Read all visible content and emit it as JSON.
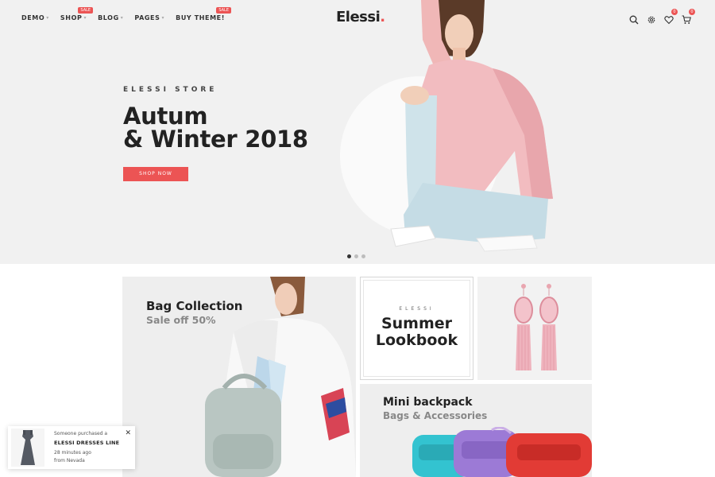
{
  "nav": {
    "items": [
      {
        "label": "DEMO",
        "has_dropdown": true,
        "badge": ""
      },
      {
        "label": "SHOP",
        "has_dropdown": true,
        "badge": "SALE"
      },
      {
        "label": "BLOG",
        "has_dropdown": true,
        "badge": ""
      },
      {
        "label": "PAGES",
        "has_dropdown": true,
        "badge": ""
      },
      {
        "label": "BUY THEME!",
        "has_dropdown": false,
        "badge": "SALE"
      }
    ]
  },
  "logo": {
    "text": "Elessi",
    "dot": "."
  },
  "header_icons": {
    "search": "search-icon",
    "settings": "gear-icon",
    "wishlist": {
      "icon": "heart-icon",
      "count": "0"
    },
    "cart": {
      "icon": "cart-icon",
      "count": "0"
    }
  },
  "hero": {
    "eyebrow": "ELESSI STORE",
    "title_line1": "Autum",
    "title_line2": "& Winter 2018",
    "button": "SHOP NOW",
    "slide_count": 3,
    "active_slide": 1
  },
  "banners": {
    "bag": {
      "title": "Bag Collection",
      "subtitle": "Sale off 50%"
    },
    "lookbook": {
      "eyebrow": "ELESSI",
      "title_line1": "Summer",
      "title_line2": "Lookbook"
    },
    "backpack": {
      "title": "Mini backpack",
      "subtitle": "Bags & Accessories"
    }
  },
  "toast": {
    "line1": "Someone purchased a",
    "product": "ELESSI DRESSES LINE",
    "time": "28 minutes ago",
    "location": "from Nevada"
  },
  "colors": {
    "accent": "#ec5454",
    "text": "#222222",
    "hero_bg": "#f1f1f1"
  }
}
